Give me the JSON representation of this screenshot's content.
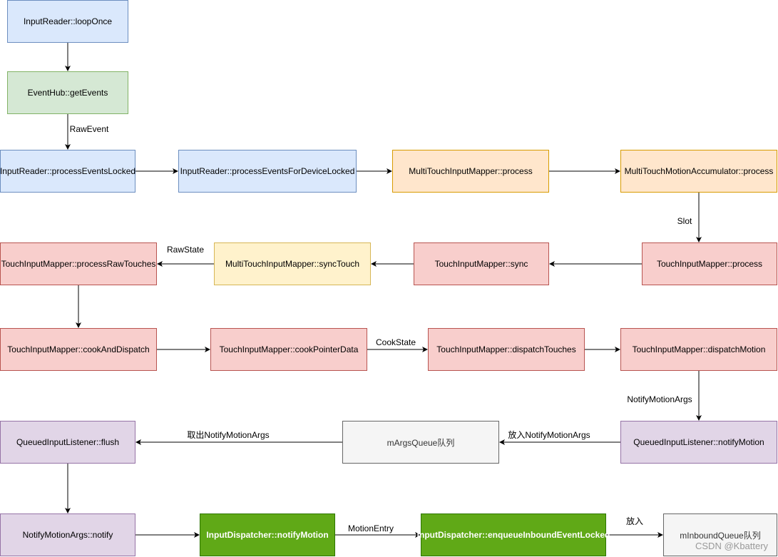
{
  "nodes": {
    "loop_once": "InputReader::loopOnce",
    "get_events": "EventHub::getEvents",
    "process_events_locked": "InputReader::processEventsLocked",
    "process_events_device": "InputReader::processEventsForDeviceLocked",
    "mt_mapper_process": "MultiTouchInputMapper::process",
    "mt_accum_process": "MultiTouchMotionAccumulator::process",
    "raw_touches": "TouchInputMapper::processRawTouches",
    "sync_touch": "MultiTouchInputMapper::syncTouch",
    "sync": "TouchInputMapper::sync",
    "touch_process": "TouchInputMapper::process",
    "cook_dispatch": "TouchInputMapper::cookAndDispatch",
    "cook_pointer": "TouchInputMapper::cookPointerData",
    "dispatch_touches": "TouchInputMapper::dispatchTouches",
    "dispatch_motion": "TouchInputMapper::dispatchMotion",
    "flush": "QueuedInputListener::flush",
    "args_queue": "mArgsQueue队列",
    "notify_motion_listener": "QueuedInputListener::notifyMotion",
    "args_notify": "NotifyMotionArgs::notify",
    "dispatcher_notify": "InputDispatcher::notifyMotion",
    "enqueue": "InputDispatcher::enqueueInboundEventLocked",
    "inbound_queue": "mInboundQueue队列"
  },
  "edge_labels": {
    "raw_event": "RawEvent",
    "slot": "Slot",
    "raw_state": "RawState",
    "cook_state": "CookState",
    "notify_motion_args": "NotifyMotionArgs",
    "take_out": "取出NotifyMotionArgs",
    "put_in": "放入NotifyMotionArgs",
    "motion_entry": "MotionEntry",
    "put": "放入"
  },
  "watermark": "CSDN @Kbattery"
}
